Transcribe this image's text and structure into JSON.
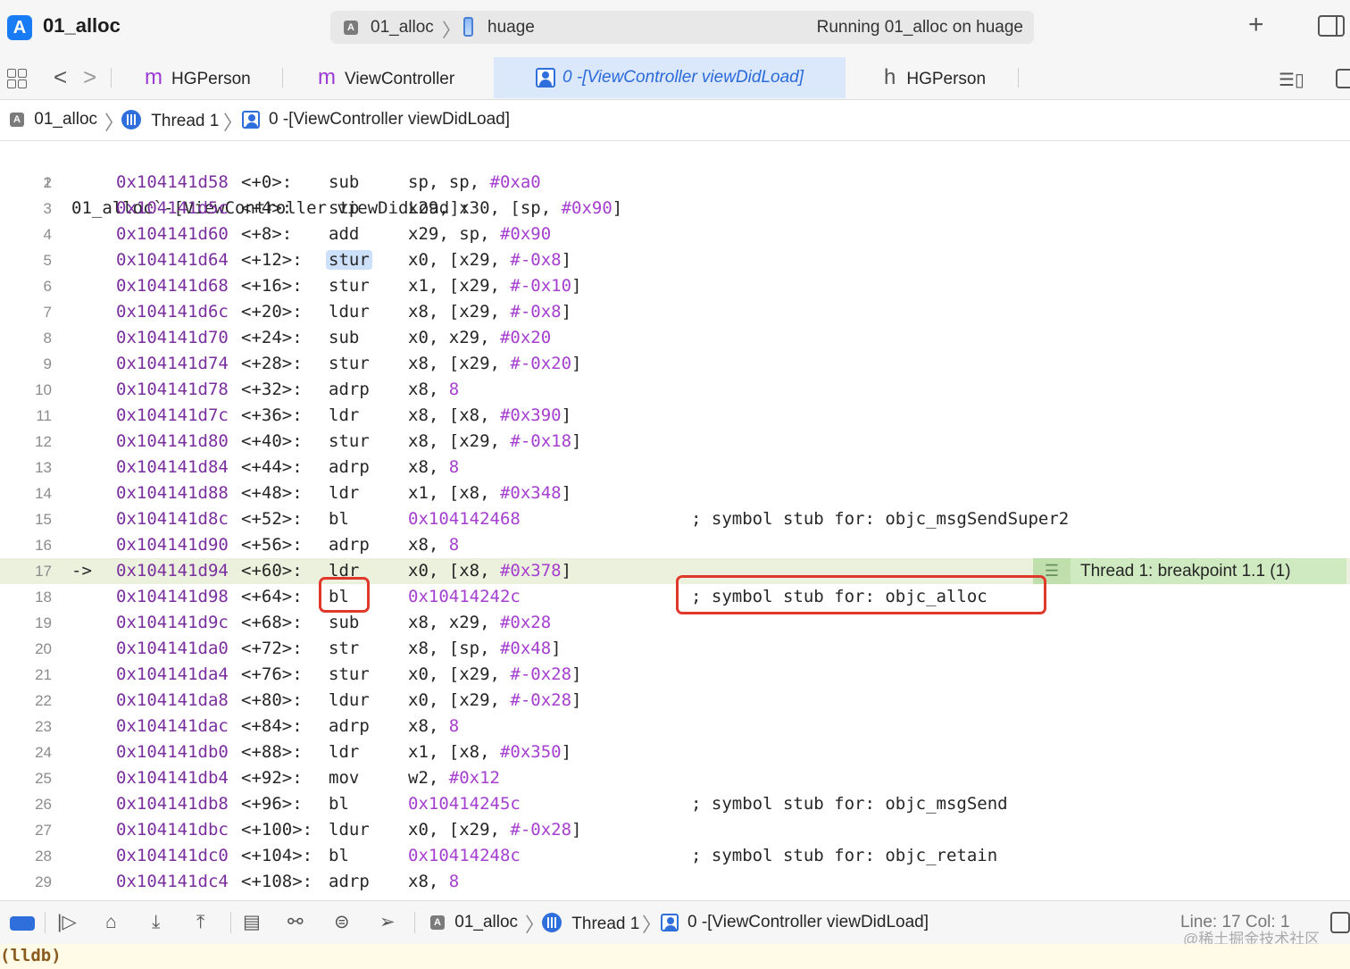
{
  "window": {
    "title": "01_alloc",
    "scheme_target": "01_alloc",
    "scheme_device": "huage",
    "status": "Running 01_alloc on huage",
    "plus_label": "+"
  },
  "tabs": [
    {
      "glyph": "m",
      "label": "HGPerson"
    },
    {
      "glyph": "m",
      "label": "ViewController"
    },
    {
      "glyph": "",
      "label": "0 -[ViewController viewDidLoad]"
    },
    {
      "glyph": "h",
      "label": "HGPerson"
    }
  ],
  "jumpbar": {
    "project": "01_alloc",
    "thread": "Thread 1",
    "frame": "0 -[ViewController viewDidLoad]"
  },
  "code": {
    "header": "01_alloc`-[ViewController viewDidLoad]:",
    "current_line": 17,
    "current_arrow": "->",
    "breakpoint_badge": "Thread 1: breakpoint 1.1 (1)",
    "lines": [
      {
        "n": "2",
        "addr": "0x104141d58",
        "off": "<+0>:",
        "mn": "sub",
        "ops": "sp, sp, ",
        "num": "#0xa0",
        "tail": "",
        "cmt": ""
      },
      {
        "n": "3",
        "addr": "0x104141d5c",
        "off": "<+4>:",
        "mn": "stp",
        "ops": "x29, x30, [sp, ",
        "num": "#0x90",
        "tail": "]",
        "cmt": ""
      },
      {
        "n": "4",
        "addr": "0x104141d60",
        "off": "<+8>:",
        "mn": "add",
        "ops": "x29, sp, ",
        "num": "#0x90",
        "tail": "",
        "cmt": ""
      },
      {
        "n": "5",
        "addr": "0x104141d64",
        "off": "<+12>:",
        "mn": "stur",
        "ops": "x0, [x29, ",
        "num": "#-0x8",
        "tail": "]",
        "cmt": ""
      },
      {
        "n": "6",
        "addr": "0x104141d68",
        "off": "<+16>:",
        "mn": "stur",
        "ops": "x1, [x29, ",
        "num": "#-0x10",
        "tail": "]",
        "cmt": ""
      },
      {
        "n": "7",
        "addr": "0x104141d6c",
        "off": "<+20>:",
        "mn": "ldur",
        "ops": "x8, [x29, ",
        "num": "#-0x8",
        "tail": "]",
        "cmt": ""
      },
      {
        "n": "8",
        "addr": "0x104141d70",
        "off": "<+24>:",
        "mn": "sub",
        "ops": "x0, x29, ",
        "num": "#0x20",
        "tail": "",
        "cmt": ""
      },
      {
        "n": "9",
        "addr": "0x104141d74",
        "off": "<+28>:",
        "mn": "stur",
        "ops": "x8, [x29, ",
        "num": "#-0x20",
        "tail": "]",
        "cmt": ""
      },
      {
        "n": "10",
        "addr": "0x104141d78",
        "off": "<+32>:",
        "mn": "adrp",
        "ops": "x8, ",
        "num": "8",
        "tail": "",
        "cmt": ""
      },
      {
        "n": "11",
        "addr": "0x104141d7c",
        "off": "<+36>:",
        "mn": "ldr",
        "ops": "x8, [x8, ",
        "num": "#0x390",
        "tail": "]",
        "cmt": ""
      },
      {
        "n": "12",
        "addr": "0x104141d80",
        "off": "<+40>:",
        "mn": "stur",
        "ops": "x8, [x29, ",
        "num": "#-0x18",
        "tail": "]",
        "cmt": ""
      },
      {
        "n": "13",
        "addr": "0x104141d84",
        "off": "<+44>:",
        "mn": "adrp",
        "ops": "x8, ",
        "num": "8",
        "tail": "",
        "cmt": ""
      },
      {
        "n": "14",
        "addr": "0x104141d88",
        "off": "<+48>:",
        "mn": "ldr",
        "ops": "x1, [x8, ",
        "num": "#0x348",
        "tail": "]",
        "cmt": ""
      },
      {
        "n": "15",
        "addr": "0x104141d8c",
        "off": "<+52>:",
        "mn": "bl",
        "ops": "",
        "num": "0x104142468",
        "tail": "",
        "cmt": "; symbol stub for: objc_msgSendSuper2"
      },
      {
        "n": "16",
        "addr": "0x104141d90",
        "off": "<+56>:",
        "mn": "adrp",
        "ops": "x8, ",
        "num": "8",
        "tail": "",
        "cmt": ""
      },
      {
        "n": "17",
        "addr": "0x104141d94",
        "off": "<+60>:",
        "mn": "ldr",
        "ops": "x0, [x8, ",
        "num": "#0x378",
        "tail": "]",
        "cmt": ""
      },
      {
        "n": "18",
        "addr": "0x104141d98",
        "off": "<+64>:",
        "mn": "bl",
        "ops": "",
        "num": "0x10414242c",
        "tail": "",
        "cmt": "; symbol stub for: objc_alloc"
      },
      {
        "n": "19",
        "addr": "0x104141d9c",
        "off": "<+68>:",
        "mn": "sub",
        "ops": "x8, x29, ",
        "num": "#0x28",
        "tail": "",
        "cmt": ""
      },
      {
        "n": "20",
        "addr": "0x104141da0",
        "off": "<+72>:",
        "mn": "str",
        "ops": "x8, [sp, ",
        "num": "#0x48",
        "tail": "]",
        "cmt": ""
      },
      {
        "n": "21",
        "addr": "0x104141da4",
        "off": "<+76>:",
        "mn": "stur",
        "ops": "x0, [x29, ",
        "num": "#-0x28",
        "tail": "]",
        "cmt": ""
      },
      {
        "n": "22",
        "addr": "0x104141da8",
        "off": "<+80>:",
        "mn": "ldur",
        "ops": "x0, [x29, ",
        "num": "#-0x28",
        "tail": "]",
        "cmt": ""
      },
      {
        "n": "23",
        "addr": "0x104141dac",
        "off": "<+84>:",
        "mn": "adrp",
        "ops": "x8, ",
        "num": "8",
        "tail": "",
        "cmt": ""
      },
      {
        "n": "24",
        "addr": "0x104141db0",
        "off": "<+88>:",
        "mn": "ldr",
        "ops": "x1, [x8, ",
        "num": "#0x350",
        "tail": "]",
        "cmt": ""
      },
      {
        "n": "25",
        "addr": "0x104141db4",
        "off": "<+92>:",
        "mn": "mov",
        "ops": "w2, ",
        "num": "#0x12",
        "tail": "",
        "cmt": ""
      },
      {
        "n": "26",
        "addr": "0x104141db8",
        "off": "<+96>:",
        "mn": "bl",
        "ops": "",
        "num": "0x10414245c",
        "tail": "",
        "cmt": "; symbol stub for: objc_msgSend"
      },
      {
        "n": "27",
        "addr": "0x104141dbc",
        "off": "<+100>:",
        "mn": "ldur",
        "ops": "x0, [x29, ",
        "num": "#-0x28",
        "tail": "]",
        "cmt": ""
      },
      {
        "n": "28",
        "addr": "0x104141dc0",
        "off": "<+104>:",
        "mn": "bl",
        "ops": "",
        "num": "0x10414248c",
        "tail": "",
        "cmt": "; symbol stub for: objc_retain"
      },
      {
        "n": "29",
        "addr": "0x104141dc4",
        "off": "<+108>:",
        "mn": "adrp",
        "ops": "x8, ",
        "num": "8",
        "tail": "",
        "cmt": ""
      }
    ]
  },
  "debugbar": {
    "project": "01_alloc",
    "thread": "Thread 1",
    "frame": "0 -[ViewController viewDidLoad]",
    "line_col": "Line: 17  Col: 1",
    "watermark": "@稀土掘金技术社区"
  },
  "console": {
    "prompt": "(lldb)"
  },
  "colors": {
    "accent": "#2f6fdc",
    "address": "#7a2f9e",
    "immediate": "#a53fcf",
    "highlight_box": "#e0392b",
    "current_line_bg": "#ecf1dd",
    "breakpoint_bg": "#cfe9c0"
  }
}
